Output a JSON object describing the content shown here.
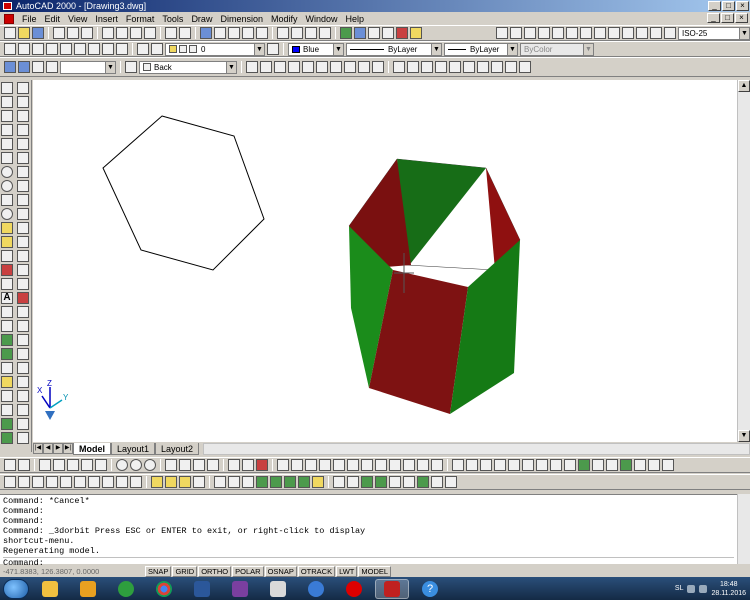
{
  "window": {
    "title": "AutoCAD 2000 - [Drawing3.dwg]"
  },
  "menu": [
    "File",
    "Edit",
    "View",
    "Insert",
    "Format",
    "Tools",
    "Draw",
    "Dimension",
    "Modify",
    "Window",
    "Help"
  ],
  "standard_toolbar": {
    "dimstyle": "ISO-25"
  },
  "layers_toolbar": {
    "layer": "0"
  },
  "properties_toolbar": {
    "color": "Blue",
    "color_hex": "#0000ff",
    "linetype": "ByLayer",
    "lineweight": "ByLayer",
    "plotstyle": "ByColor"
  },
  "view_toolbar": {
    "named_view": "Back"
  },
  "ucs": {
    "x": "X",
    "y": "Y",
    "z": "Z"
  },
  "tabs": {
    "model": "Model",
    "layout1": "Layout1",
    "layout2": "Layout2"
  },
  "command_history": [
    "Command: *Cancel*",
    "Command:",
    "Command:",
    "Command: _3dorbit Press ESC or ENTER to exit, or right-click to display",
    "shortcut-menu.",
    "Regenerating model."
  ],
  "command_prompt": "Command:",
  "status": {
    "coords": "-471.8383, 126.3807, 0.0000",
    "buttons": [
      "SNAP",
      "GRID",
      "ORTHO",
      "POLAR",
      "OSNAP",
      "OTRACK",
      "LWT",
      "MODEL"
    ]
  },
  "tray": {
    "language": "SL",
    "time": "18:48",
    "date": "28.11.2016"
  },
  "colors": {
    "solid_green": "#1b8c1b",
    "solid_red": "#8a1212",
    "title_blue": "#0a246a"
  }
}
